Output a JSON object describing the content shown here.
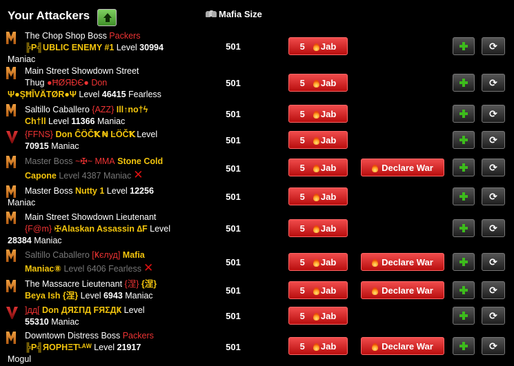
{
  "header": {
    "title": "Your Attackers",
    "sort_icon": "up-arrow-icon",
    "mafia_size_label": "Mafia Size"
  },
  "buttons": {
    "jab_label": "Jab",
    "declare_war_label": "Declare War",
    "refresh_glyph": "⟳"
  },
  "attackers": [
    {
      "badge": "m",
      "l1a": "The Chop Shop Boss ",
      "l1b": "Packers",
      "l2a": "╠P╣UBLIC ENEMY #1",
      "l2b": " Level ",
      "l2c": "30994",
      "l3": "Maniac",
      "size": "501",
      "stamina": "5",
      "war": false
    },
    {
      "badge": "m",
      "l1a": "Main Street Showdown Street",
      "l2a": "Thug ",
      "l2b": "●ĦØЯĐЄ● Don",
      "l3a": "Ψ●ȘĦĪVÄTØR●Ψ",
      "l3b": " Level ",
      "l3c": "46415",
      "l3d": " Fearless",
      "size": "501",
      "stamina": "5",
      "war": false
    },
    {
      "badge": "m",
      "l1a": "Saltillo Caballero ",
      "l1b": "{AZZ}",
      "l1c": " Ill↑no†ϟ",
      "l2a": "Ch†ll",
      "l2b": " Level ",
      "l2c": "11366",
      "l2d": " Maniac",
      "size": "501",
      "stamina": "5",
      "war": false
    },
    {
      "badge": "v",
      "l1a": "{FFNS}",
      "l1b": " Don ĈÖČꝀ ₦ ĿÖČꝀ",
      "l1c": " Level",
      "l2": "70915",
      "l2b": " Maniac",
      "size": "501",
      "stamina": "5",
      "war": false
    },
    {
      "badge": "m",
      "l1a": "Master Boss ",
      "l1b": "~✠~ MMA",
      "l1c": " Stone Cold",
      "l2a": "Capone",
      "l2b": " Level 4387 Maniac",
      "size": "501",
      "stamina": "5",
      "war": true,
      "dead": true
    },
    {
      "badge": "m",
      "l1a": "Master Boss ",
      "l1b": "Nutty 1",
      "l1c": " Level ",
      "l1d": "12256",
      "l2": "Maniac",
      "size": "501",
      "stamina": "5",
      "war": false
    },
    {
      "badge": "m",
      "l1a": "Main Street Showdown Lieutenant",
      "l2a": "{F@m}",
      "l2b": " ✠Alaskan Assassin ∆F",
      "l2c": " Level",
      "l3a": "28384",
      "l3b": " Maniac",
      "size": "501",
      "stamina": "5",
      "war": false
    },
    {
      "badge": "m",
      "l1a": "Saltillo Caballero ",
      "l1b": "[Ҝєлуд]",
      "l1c": " Mafia",
      "l2a": "Maniac⑧",
      "l2b": " Level 6406 Fearless",
      "size": "501",
      "stamina": "5",
      "war": true,
      "dead": true
    },
    {
      "badge": "m",
      "l1a": "The Massacre Lieutenant ",
      "l1b": "{涅}",
      "l1c": " {涅}",
      "l2a": "Beya Ish {涅}",
      "l2b": " Level ",
      "l2c": "6943",
      "l2d": " Maniac",
      "size": "501",
      "stamina": "5",
      "war": true
    },
    {
      "badge": "v",
      "l1a": "]дд[",
      "l1b": " Don ДЯΣПД FЯΣДҜ",
      "l1c": " Level",
      "l2": "55310",
      "l2b": " Maniac",
      "size": "501",
      "stamina": "5",
      "war": false
    },
    {
      "badge": "m",
      "l1a": "Downtown Distress Boss ",
      "l1b": "Packers",
      "l2a": "╠P╣ЯOPHΞTᴸᴬᵂ",
      "l2b": " Level ",
      "l2c": "21917",
      "l3": "Mogul",
      "size": "501",
      "stamina": "5",
      "war": true
    }
  ]
}
